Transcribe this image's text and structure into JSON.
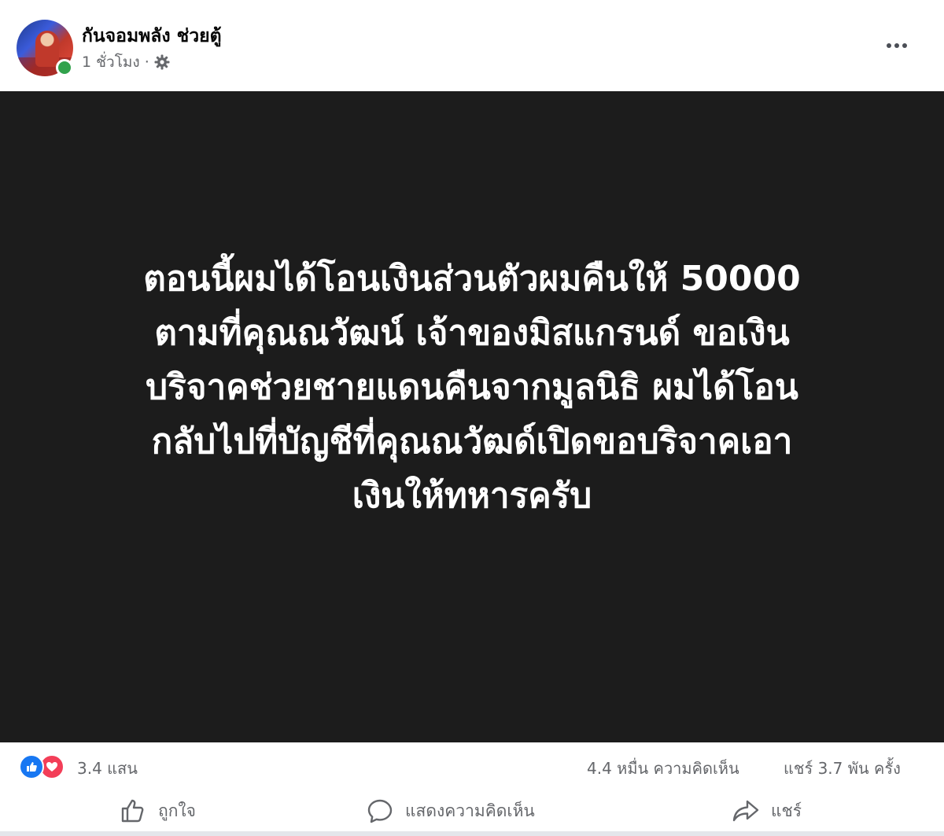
{
  "post": {
    "author_name": "กันจอมพลัง ช่วยตู้",
    "timestamp": "1 ชั่วโมง",
    "separator": "·",
    "privacy_icon": "gear-icon",
    "more_icon": "more-horizontal-icon",
    "body_lines": [
      "ตอนนี้ผมได้โอนเงินส่วนตัวผมคืนให้ 50000",
      "ตามที่คุณณวัฒน์ เจ้าของมิสแกรนด์ ขอเงิน",
      "บริจาคช่วยชายแดนคืนจากมูลนิธิ ผมได้โอน",
      "กลับไปที่บัญชีที่คุณณวัฒด์เปิดขอบริจาคเอา",
      "เงินให้ทหารครับ"
    ],
    "body_background": "#1c1c1c",
    "body_text_color": "#ffffff"
  },
  "stats": {
    "reactions": [
      "like",
      "love"
    ],
    "reaction_count": "3.4 แสน",
    "comment_count": "4.4 หมื่น ความคิดเห็น",
    "share_count": "แชร์ 3.7 พัน ครั้ง"
  },
  "actions": {
    "like_label": "ถูกใจ",
    "comment_label": "แสดงความคิดเห็น",
    "share_label": "แชร์"
  },
  "colors": {
    "like_blue": "#1877f2",
    "love_red": "#f33e58",
    "online_green": "#31a24c",
    "secondary_text": "#65676b"
  }
}
